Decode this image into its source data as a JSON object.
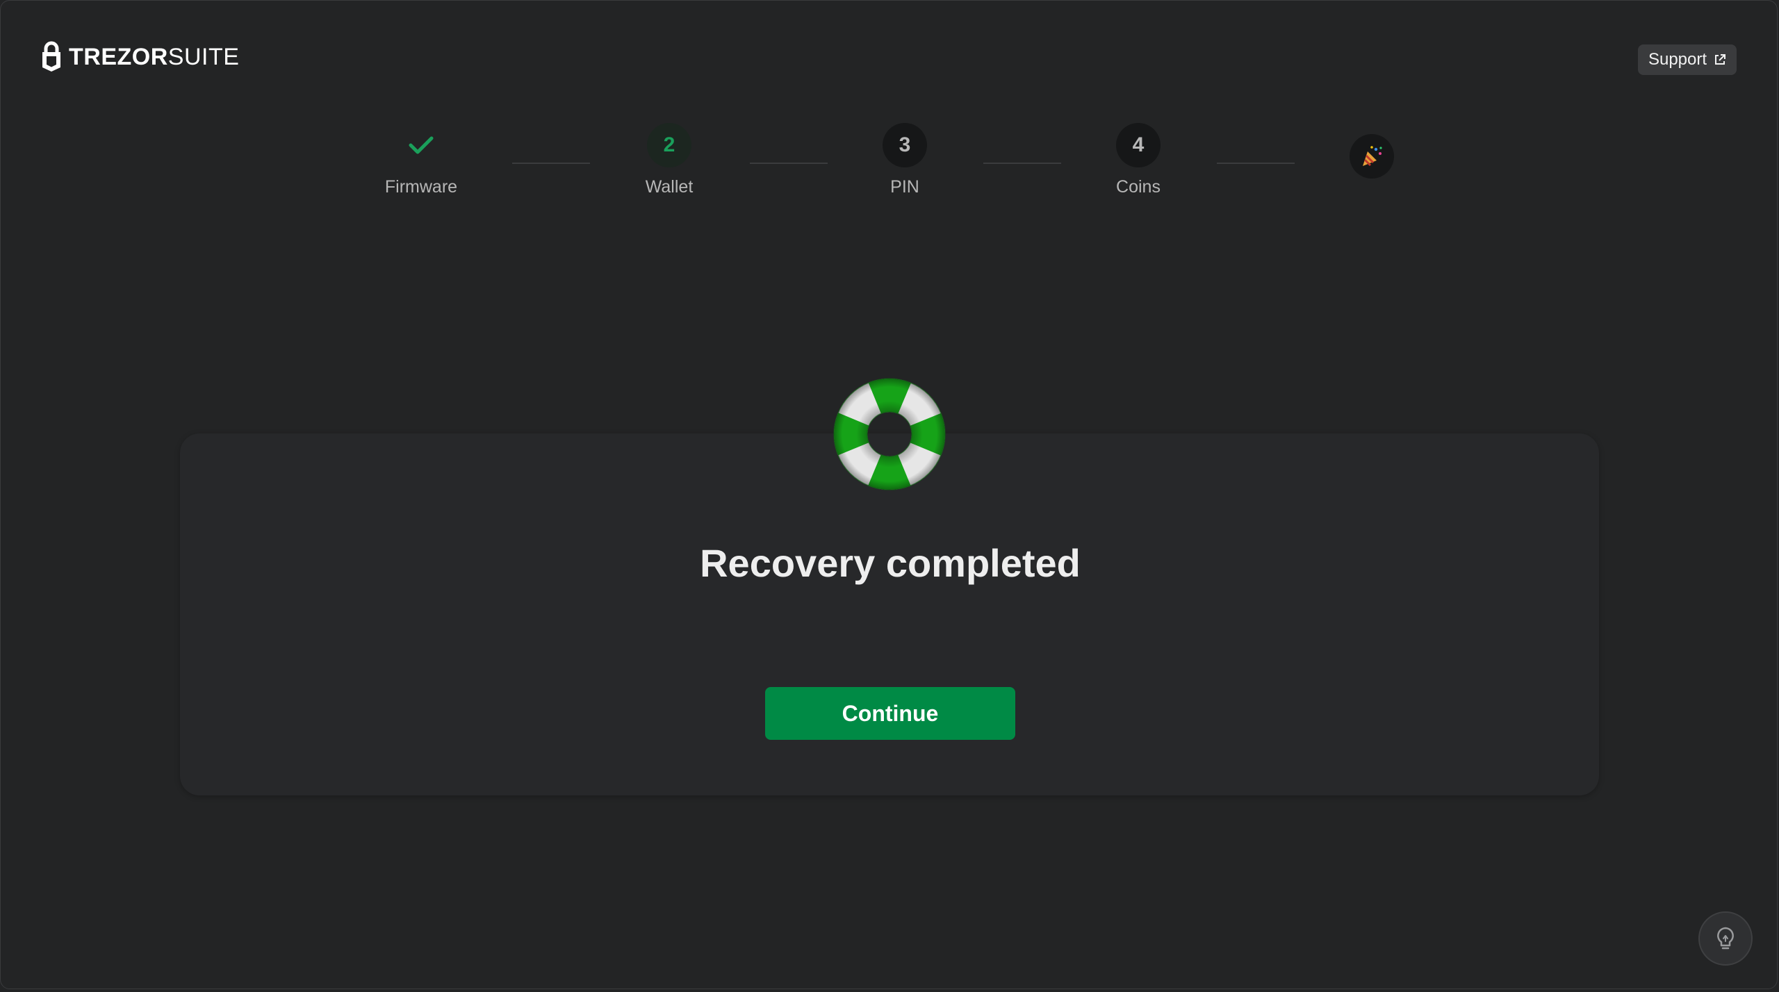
{
  "brand": {
    "name_bold": "TREZOR",
    "name_light": "SUITE"
  },
  "header": {
    "support_label": "Support"
  },
  "stepper": {
    "steps": [
      {
        "label": "Firmware",
        "marker": "",
        "state": "done"
      },
      {
        "label": "Wallet",
        "marker": "2",
        "state": "active"
      },
      {
        "label": "PIN",
        "marker": "3",
        "state": "pending"
      },
      {
        "label": "Coins",
        "marker": "4",
        "state": "pending"
      },
      {
        "label": "",
        "marker": "🎉",
        "state": "pending"
      }
    ]
  },
  "main": {
    "title": "Recovery completed",
    "continue_label": "Continue"
  },
  "colors": {
    "accent": "#008a45",
    "check": "#1aa05b",
    "background": "#232425",
    "card": "#27282a"
  },
  "icons": {
    "logo": "padlock-icon",
    "support": "external-link-icon",
    "done_step": "check-icon",
    "final_step": "party-popper-icon",
    "hero": "lifebuoy-icon",
    "tip": "lightbulb-icon"
  }
}
